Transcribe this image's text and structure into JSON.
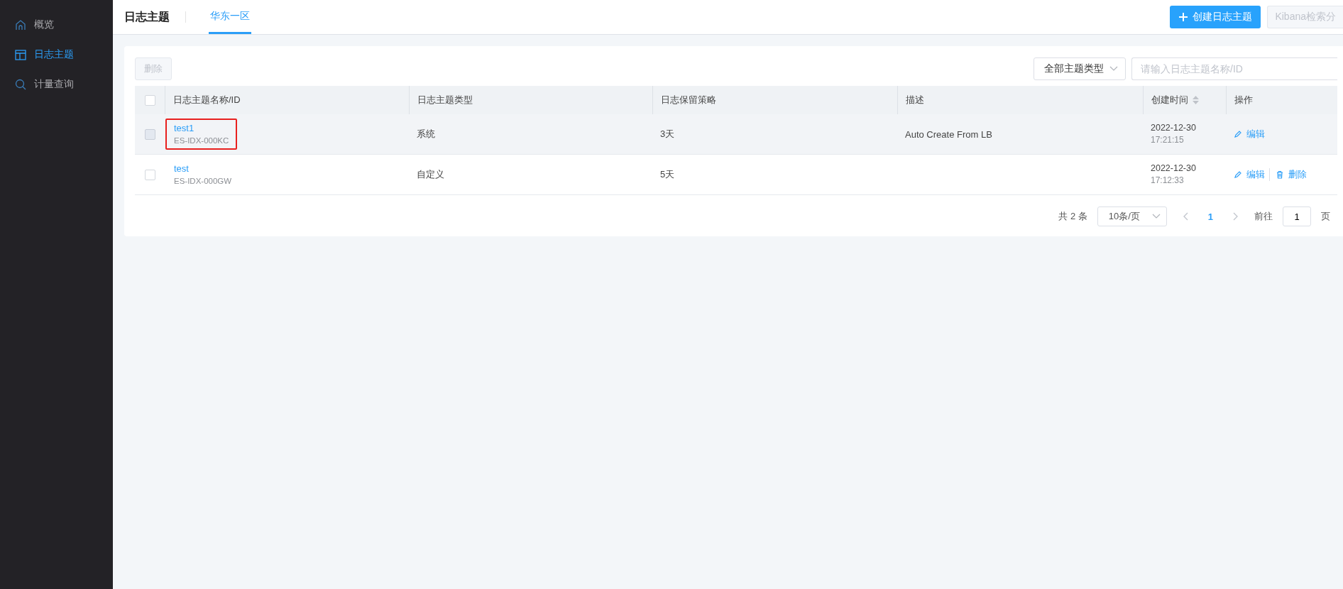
{
  "sidebar": {
    "items": [
      {
        "kind": "home",
        "label": "概览",
        "selected": false
      },
      {
        "kind": "layout",
        "label": "日志主题",
        "selected": true
      },
      {
        "kind": "search",
        "label": "计量查询",
        "selected": false
      }
    ]
  },
  "header": {
    "title": "日志主题",
    "tabs": [
      {
        "label": "华东一区",
        "selected": true
      }
    ],
    "create_button": "创建日志主题",
    "kibana_button": "Kibana检索分"
  },
  "toolbar": {
    "delete_button": "删除",
    "delete_disabled": true,
    "type_filter": "全部主题类型",
    "search": {
      "placeholder": "请输入日志主题名称/ID"
    }
  },
  "table": {
    "select_all_checked": false,
    "columns": [
      "日志主题名称/ID",
      "日志主题类型",
      "日志保留策略",
      "描述",
      "创建时间",
      "操作"
    ],
    "rows": [
      {
        "name": "test1",
        "id": "ES-IDX-000KC",
        "type": "系统",
        "retention": "3天",
        "description": "Auto Create From LB",
        "date": "2022-12-30",
        "time": "17:21:15",
        "actions": [
          {
            "kind": "edit",
            "label": "编辑"
          }
        ],
        "checked": false,
        "checkbox_disabled": true,
        "hovered": true,
        "highlighted": true
      },
      {
        "name": "test",
        "id": "ES-IDX-000GW",
        "type": "自定义",
        "retention": "5天",
        "date": "2022-12-30",
        "time": "17:12:33",
        "actions": [
          {
            "kind": "edit",
            "label": "编辑"
          },
          {
            "kind": "delete",
            "label": "删除"
          }
        ],
        "checked": false,
        "checkbox_disabled": false,
        "hovered": false,
        "highlighted": false
      }
    ]
  },
  "pagination": {
    "total": "共 2 条",
    "page_size": "10条/页",
    "pages": [
      {
        "label": "1",
        "selected": true
      }
    ],
    "goto_label": "前往",
    "goto_value": "1",
    "page_suffix": "页"
  }
}
